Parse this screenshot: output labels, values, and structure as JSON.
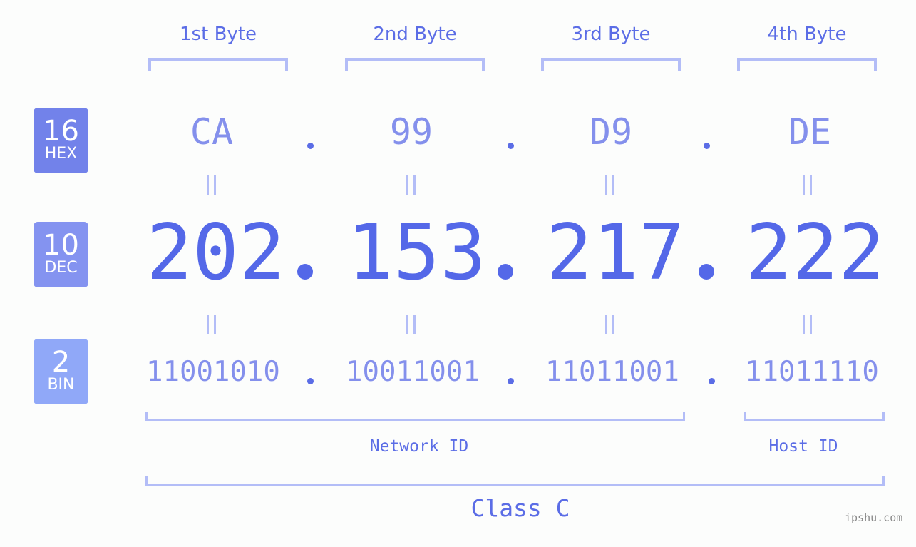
{
  "byte_headers": [
    "1st Byte",
    "2nd Byte",
    "3rd Byte",
    "4th Byte"
  ],
  "badges": {
    "hex": {
      "number": "16",
      "label": "HEX",
      "color": "#7282ea"
    },
    "dec": {
      "number": "10",
      "label": "DEC",
      "color": "#8493f0"
    },
    "bin": {
      "number": "2",
      "label": "BIN",
      "color": "#90a8f8"
    }
  },
  "hex_values": [
    "CA",
    "99",
    "D9",
    "DE"
  ],
  "dec_values": [
    "202",
    "153",
    "217",
    "222"
  ],
  "bin_values": [
    "11001010",
    "10011001",
    "11011001",
    "11011110"
  ],
  "separator": ".",
  "equals_symbol": "=",
  "network_id_label": "Network ID",
  "host_id_label": "Host ID",
  "class_label": "Class C",
  "watermark": "ipshu.com",
  "colors": {
    "primary": "#5468e8",
    "light": "#8490ec",
    "bracket": "#b3bdf7"
  }
}
